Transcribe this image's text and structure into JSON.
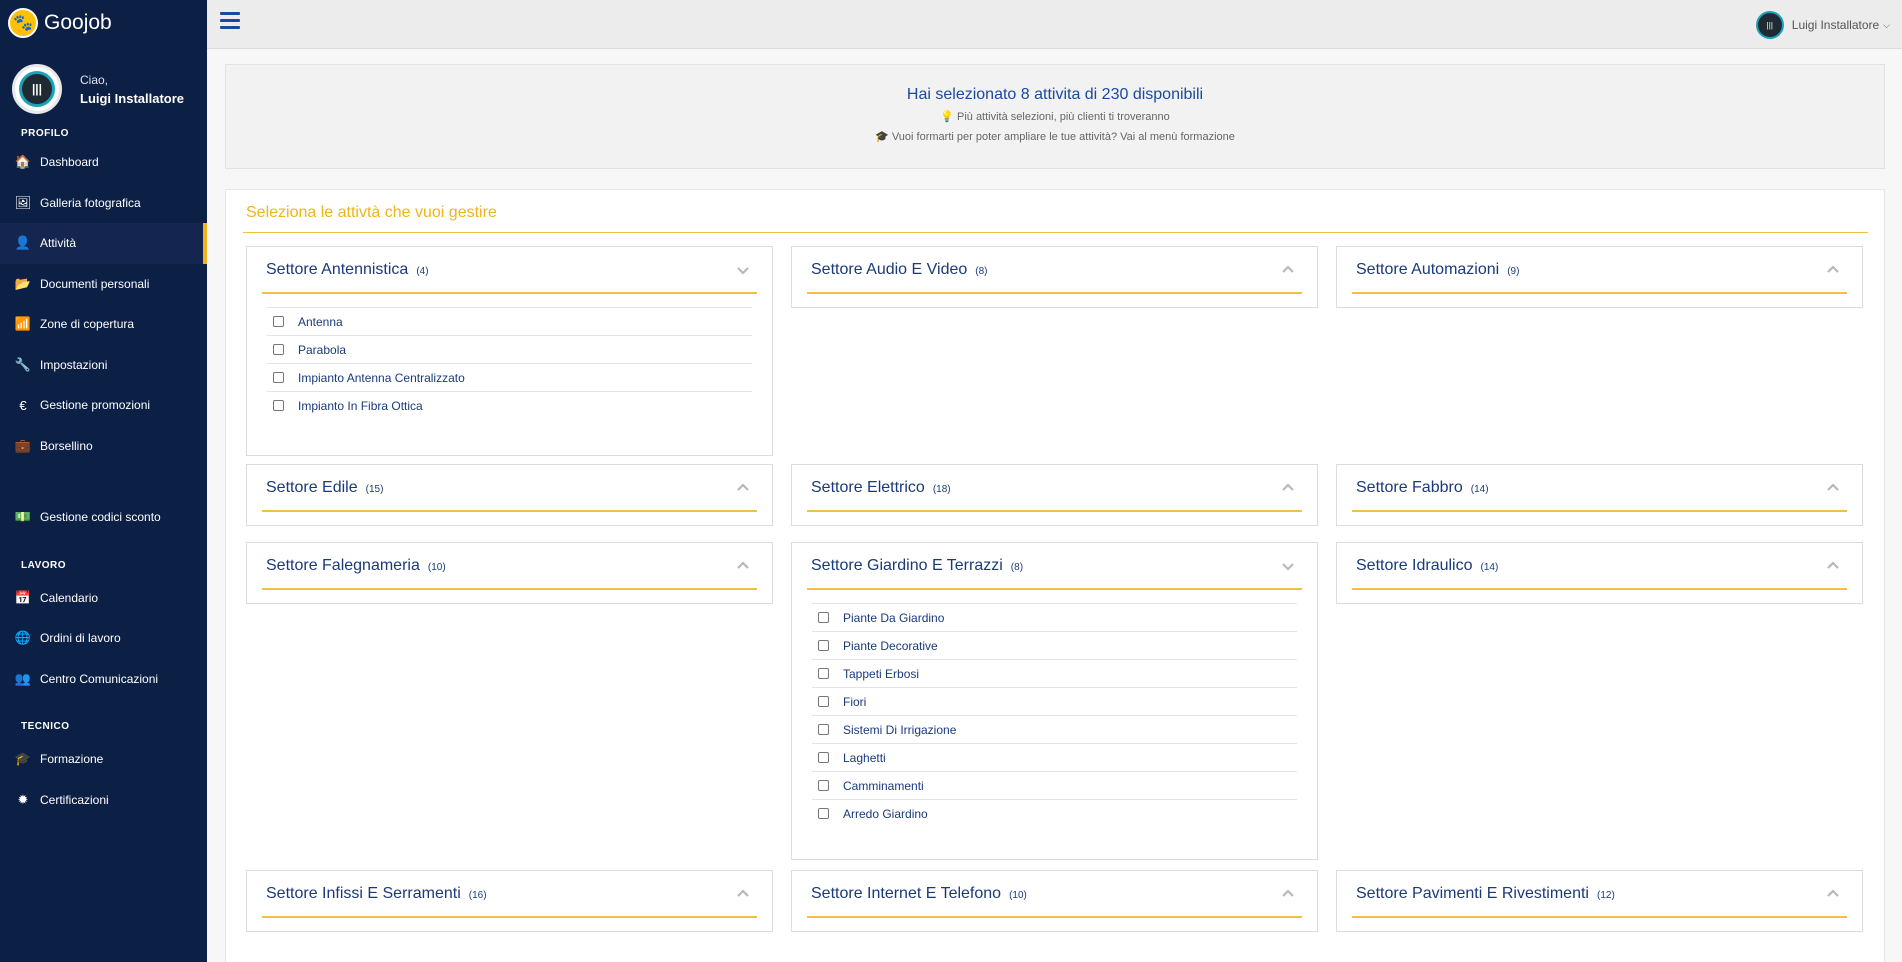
{
  "brand": {
    "name": "Goojob",
    "logo_icon": "paw-icon"
  },
  "profile": {
    "greeting": "Ciao,",
    "name": "Luigi Installatore"
  },
  "sidebar": {
    "section_profile": "PROFILO",
    "profile_items": [
      {
        "label": "Dashboard",
        "icon": "🏠"
      },
      {
        "label": "Galleria fotografica",
        "icon": "🖼"
      },
      {
        "label": "Attività",
        "icon": "👤"
      },
      {
        "label": "Documenti personali",
        "icon": "📂"
      },
      {
        "label": "Zone di copertura",
        "icon": "📶"
      },
      {
        "label": "Impostazioni",
        "icon": "🔧"
      },
      {
        "label": "Gestione promozioni",
        "icon": "€"
      },
      {
        "label": "Borsellino",
        "icon": "💼"
      },
      {
        "label": "Gestione codici sconto",
        "icon": "💵"
      }
    ],
    "section_lavoro": "LAVORO",
    "lavoro_items": [
      {
        "label": "Calendario",
        "icon": "📅"
      },
      {
        "label": "Ordini di lavoro",
        "icon": "🌐"
      },
      {
        "label": "Centro Comunicazioni",
        "icon": "👥"
      }
    ],
    "section_tecnico": "TECNICO",
    "tecnico_items": [
      {
        "label": "Formazione",
        "icon": "🎓"
      },
      {
        "label": "Certificazioni",
        "icon": "✹"
      }
    ]
  },
  "topbar": {
    "user_label": "Luigi Installatore"
  },
  "info": {
    "main": "Hai selezionato 8 attivita di 230 disponibili",
    "sub1": "Più attività selezioni, più clienti ti troveranno",
    "sub2": "Vuoi formarti per poter ampliare le tue attività? Vai al menù formazione"
  },
  "panel": {
    "title": "Seleziona le attivtà che vuoi gestire"
  },
  "cards": [
    {
      "title": "Settore Antennistica",
      "count": "(4)",
      "expanded": true,
      "items": [
        "Antenna",
        "Parabola",
        "Impianto Antenna Centralizzato",
        "Impianto In Fibra Ottica"
      ]
    },
    {
      "title": "Settore Audio E Video",
      "count": "(8)",
      "expanded": false
    },
    {
      "title": "Settore Automazioni",
      "count": "(9)",
      "expanded": false
    },
    {
      "title": "Settore Edile",
      "count": "(15)",
      "expanded": false
    },
    {
      "title": "Settore Elettrico",
      "count": "(18)",
      "expanded": false
    },
    {
      "title": "Settore Fabbro",
      "count": "(14)",
      "expanded": false
    },
    {
      "title": "Settore Falegnameria",
      "count": "(10)",
      "expanded": false
    },
    {
      "title": "Settore Giardino E Terrazzi",
      "count": "(8)",
      "expanded": true,
      "items": [
        "Piante Da Giardino",
        "Piante Decorative",
        "Tappeti Erbosi",
        "Fiori",
        "Sistemi Di Irrigazione",
        "Laghetti",
        "Camminamenti",
        "Arredo Giardino"
      ]
    },
    {
      "title": "Settore Idraulico",
      "count": "(14)",
      "expanded": false
    },
    {
      "title": "Settore Infissi E Serramenti",
      "count": "(16)",
      "expanded": false
    },
    {
      "title": "Settore Internet E Telefono",
      "count": "(10)",
      "expanded": false
    },
    {
      "title": "Settore Pavimenti E Rivestimenti",
      "count": "(12)",
      "expanded": false
    }
  ],
  "colors": {
    "sidebar": "#0c1f45",
    "accent": "#f0b41c",
    "link": "#1a3a7a"
  }
}
